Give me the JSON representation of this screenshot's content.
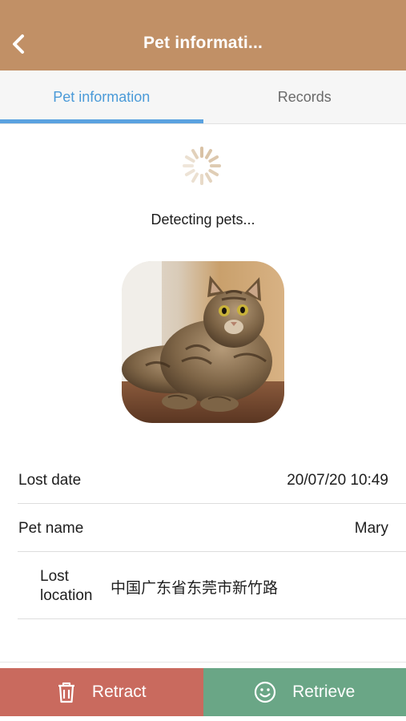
{
  "header": {
    "title": "Pet informati...",
    "bg_color": "#c19066",
    "back_icon": "chevron-left-icon"
  },
  "tabs": [
    {
      "label": "Pet information",
      "active": true,
      "color": "#4a9ad8"
    },
    {
      "label": "Records",
      "active": false,
      "color": "#6a6a6a"
    }
  ],
  "status": {
    "text": "Detecting pets...",
    "icon": "loading-spinner-icon"
  },
  "pet_photo": {
    "icon": "tabby-cat-photo"
  },
  "details": {
    "lost_date": {
      "label": "Lost date",
      "value": "20/07/20 10:49"
    },
    "pet_name": {
      "label": "Pet name",
      "value": "Mary"
    },
    "lost_location": {
      "label_line1": "Lost",
      "label_line2": "location",
      "value": "中国广东省东莞市新竹路"
    }
  },
  "actions": {
    "retract": {
      "label": "Retract",
      "icon": "trash-icon",
      "color": "#c96a5e"
    },
    "retrieve": {
      "label": "Retrieve",
      "icon": "smiley-icon",
      "color": "#6aa686"
    }
  }
}
